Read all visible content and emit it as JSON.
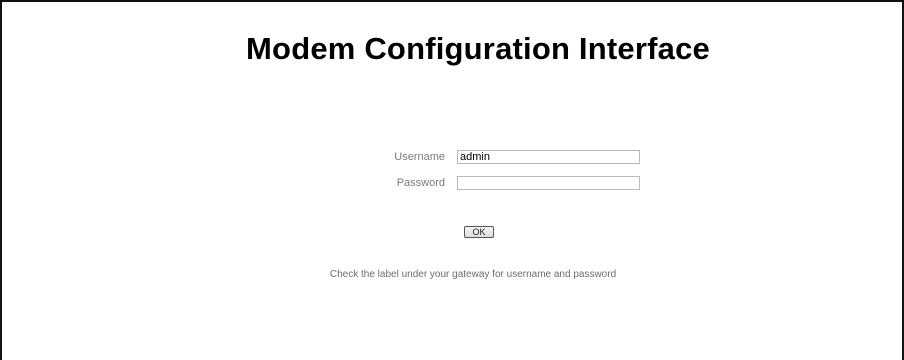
{
  "page": {
    "title": "Modem Configuration Interface"
  },
  "login_form": {
    "username_label": "Username",
    "username_value": "admin",
    "password_label": "Password",
    "password_value": "",
    "submit_label": "OK",
    "hint": "Check the label under your gateway for username and password"
  }
}
